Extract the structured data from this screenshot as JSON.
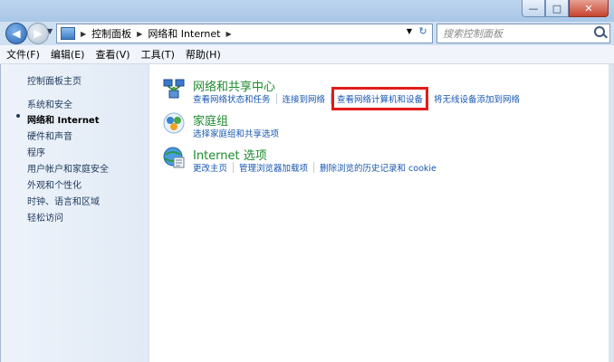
{
  "address_bar": {
    "crumbs": [
      "控制面板",
      "网络和 Internet"
    ],
    "search_placeholder": "搜索控制面板"
  },
  "window_buttons": {
    "minimize": "—",
    "maximize": "□",
    "close": "✕"
  },
  "menu": [
    "文件(F)",
    "编辑(E)",
    "查看(V)",
    "工具(T)",
    "帮助(H)"
  ],
  "left_nav": {
    "items": [
      "控制面板主页",
      "系统和安全",
      "网络和 Internet",
      "硬件和声音",
      "程序",
      "用户帐户和家庭安全",
      "外观和个性化",
      "时钟、语言和区域",
      "轻松访问"
    ],
    "current": "网络和 Internet"
  },
  "categories": [
    {
      "title": "网络和共享中心",
      "icon": "network-sharing-center-icon",
      "links": [
        "查看网络状态和任务",
        "连接到网络",
        "查看网络计算机和设备",
        "将无线设备添加到网络"
      ]
    },
    {
      "title": "家庭组",
      "icon": "homegroup-icon",
      "links": [
        "选择家庭组和共享选项"
      ]
    },
    {
      "title": "Internet 选项",
      "icon": "internet-options-icon",
      "links": [
        "更改主页",
        "管理浏览器加载项",
        "删除浏览的历史记录和 cookie"
      ]
    }
  ],
  "highlight_color": "#e31b1b"
}
